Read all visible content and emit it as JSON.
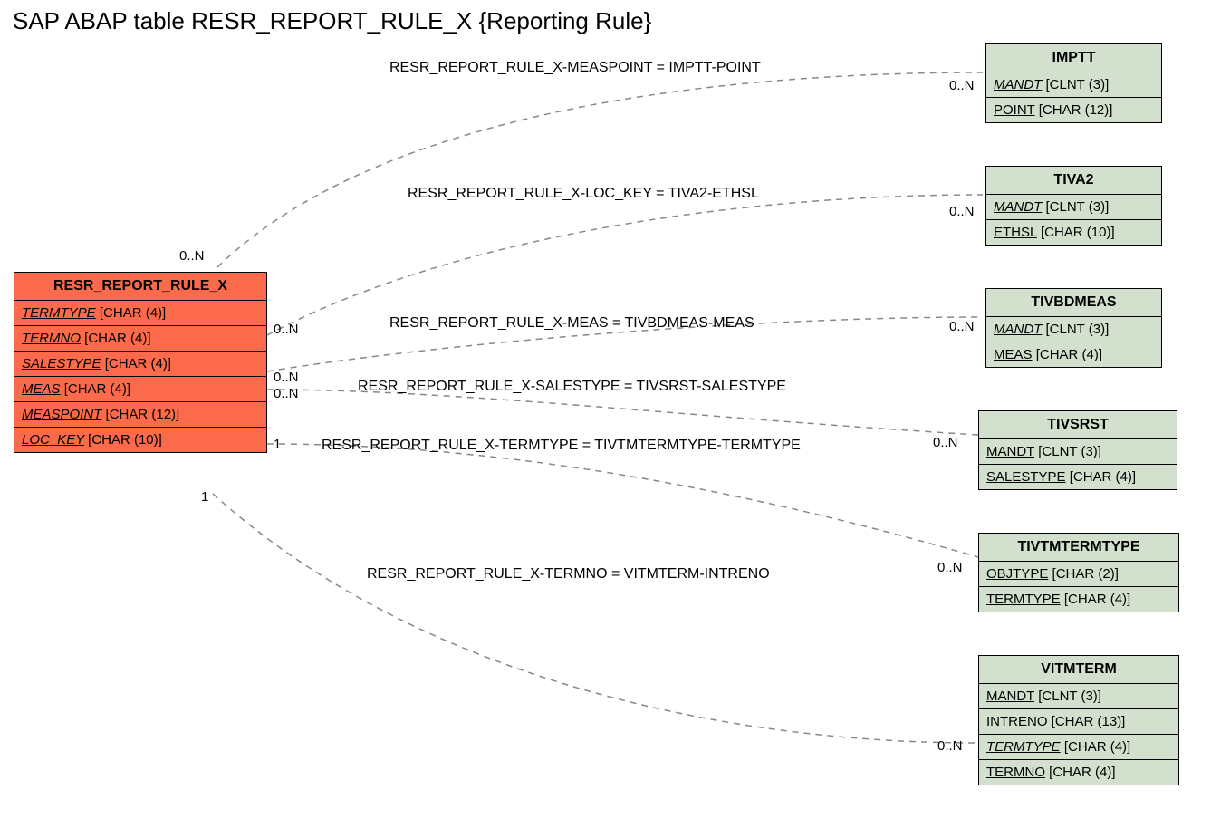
{
  "title": "SAP ABAP table RESR_REPORT_RULE_X {Reporting Rule}",
  "mainTable": {
    "name": "RESR_REPORT_RULE_X",
    "fields": [
      {
        "name": "TERMTYPE",
        "type": "[CHAR (4)]"
      },
      {
        "name": "TERMNO",
        "type": "[CHAR (4)]"
      },
      {
        "name": "SALESTYPE",
        "type": "[CHAR (4)]"
      },
      {
        "name": "MEAS",
        "type": "[CHAR (4)]"
      },
      {
        "name": "MEASPOINT",
        "type": "[CHAR (12)]"
      },
      {
        "name": "LOC_KEY",
        "type": "[CHAR (10)]"
      }
    ]
  },
  "refTables": [
    {
      "name": "IMPTT",
      "fields": [
        {
          "name": "MANDT",
          "type": "[CLNT (3)]",
          "italic": true
        },
        {
          "name": "POINT",
          "type": "[CHAR (12)]",
          "italic": false
        }
      ]
    },
    {
      "name": "TIVA2",
      "fields": [
        {
          "name": "MANDT",
          "type": "[CLNT (3)]",
          "italic": true
        },
        {
          "name": "ETHSL",
          "type": "[CHAR (10)]",
          "italic": false
        }
      ]
    },
    {
      "name": "TIVBDMEAS",
      "fields": [
        {
          "name": "MANDT",
          "type": "[CLNT (3)]",
          "italic": true
        },
        {
          "name": "MEAS",
          "type": "[CHAR (4)]",
          "italic": false
        }
      ]
    },
    {
      "name": "TIVSRST",
      "fields": [
        {
          "name": "MANDT",
          "type": "[CLNT (3)]",
          "italic": false
        },
        {
          "name": "SALESTYPE",
          "type": "[CHAR (4)]",
          "italic": false
        }
      ]
    },
    {
      "name": "TIVTMTERMTYPE",
      "fields": [
        {
          "name": "OBJTYPE",
          "type": "[CHAR (2)]",
          "italic": false
        },
        {
          "name": "TERMTYPE",
          "type": "[CHAR (4)]",
          "italic": false
        }
      ]
    },
    {
      "name": "VITMTERM",
      "fields": [
        {
          "name": "MANDT",
          "type": "[CLNT (3)]",
          "italic": false
        },
        {
          "name": "INTRENO",
          "type": "[CHAR (13)]",
          "italic": false
        },
        {
          "name": "TERMTYPE",
          "type": "[CHAR (4)]",
          "italic": true
        },
        {
          "name": "TERMNO",
          "type": "[CHAR (4)]",
          "italic": false
        }
      ]
    }
  ],
  "relLabels": [
    "RESR_REPORT_RULE_X-MEASPOINT = IMPTT-POINT",
    "RESR_REPORT_RULE_X-LOC_KEY = TIVA2-ETHSL",
    "RESR_REPORT_RULE_X-MEAS = TIVBDMEAS-MEAS",
    "RESR_REPORT_RULE_X-SALESTYPE = TIVSRST-SALESTYPE",
    "RESR_REPORT_RULE_X-TERMTYPE = TIVTMTERMTYPE-TERMTYPE",
    "RESR_REPORT_RULE_X-TERMNO = VITMTERM-INTRENO"
  ],
  "cards": {
    "leftTop": "0..N",
    "leftR2": "0..N",
    "leftR3": "0..N",
    "leftR4": "0..N",
    "leftR5": "1",
    "leftR6": "1",
    "r1": "0..N",
    "r2": "0..N",
    "r3": "0..N",
    "r4": "0..N",
    "r5": "0..N",
    "r6": "0..N"
  }
}
